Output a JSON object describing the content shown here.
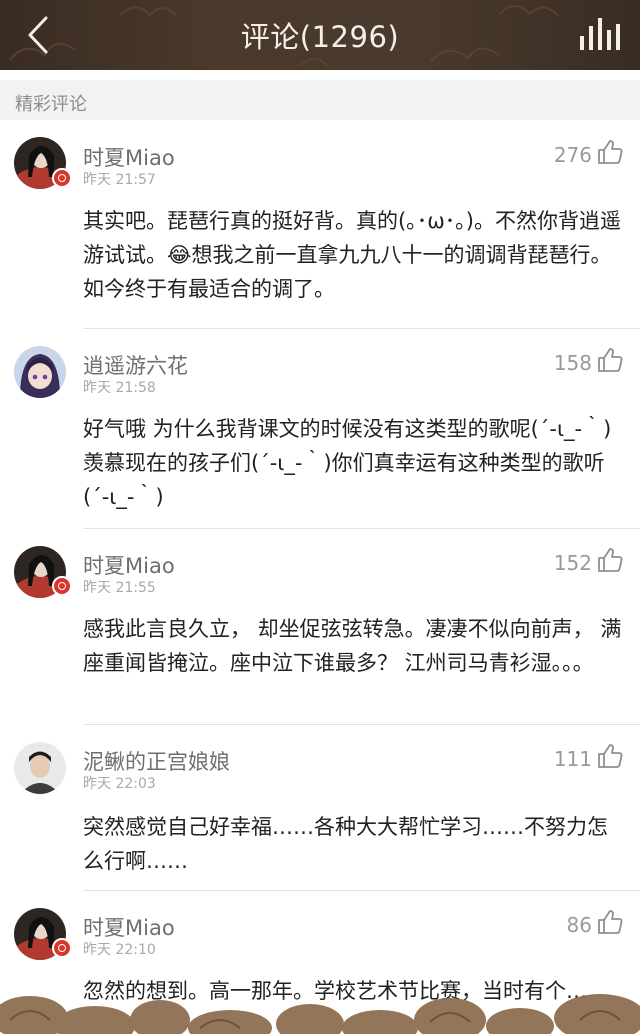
{
  "header": {
    "title": "评论(1296)",
    "back_icon": "chevron-left-icon",
    "menu_icon": "bars-icon",
    "background_color": "#463629"
  },
  "section": {
    "label": "精彩评论"
  },
  "comments": [
    {
      "username": "时夏Miao",
      "time": "昨天 21:57",
      "likes": "276",
      "text": "其实吧。琵琶行真的挺好背。真的(｡･ω･｡)。不然你背逍遥游试试。😂想我之前一直拿九九八十一的调调背琵琶行。如今终于有最适合的调了。"
    },
    {
      "username": "逍遥游六花",
      "time": "昨天 21:58",
      "likes": "158",
      "text": "好气哦 为什么我背课文的时候没有这类型的歌呢(´-ι_-｀)羡慕现在的孩子们(´-ι_-｀)你们真幸运有这种类型的歌听(´-ι_-｀)"
    },
    {
      "username": "时夏Miao",
      "time": "昨天 21:55",
      "likes": "152",
      "text": "感我此言良久立， 却坐促弦弦转急。凄凄不似向前声， 满座重闻皆掩泣。座中泣下谁最多？ 江州司马青衫湿。。。"
    },
    {
      "username": "泥鳅的正宫娘娘",
      "time": "昨天 22:03",
      "likes": "111",
      "text": "突然感觉自己好幸福……各种大大帮忙学习……不努力怎么行啊……"
    },
    {
      "username": "时夏Miao",
      "time": "昨天 22:10",
      "likes": "86",
      "text": "忽然的想到。高一那年。学校艺术节比赛，当时有个…"
    }
  ],
  "colors": {
    "accent_badge": "#d9352b",
    "divider": "#e2e2e2"
  }
}
